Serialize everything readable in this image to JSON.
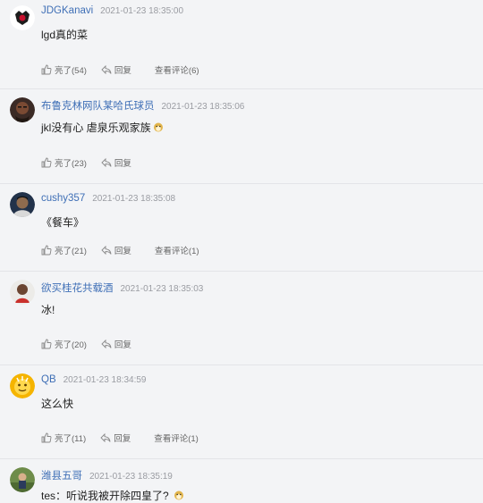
{
  "comments": [
    {
      "username": "JDGKanavi",
      "time": "2021-01-23 18:35:00",
      "text": "lgd真的菜",
      "likes": "亮了(54)",
      "reply": "回复",
      "view": "查看评论(6)"
    },
    {
      "username": "布鲁克林网队某哈氏球员",
      "time": "2021-01-23 18:35:06",
      "text": "jkl没有心 虐泉乐观家族",
      "likes": "亮了(23)",
      "reply": "回复",
      "view": ""
    },
    {
      "username": "cushy357",
      "time": "2021-01-23 18:35:08",
      "text": "《餐车》",
      "likes": "亮了(21)",
      "reply": "回复",
      "view": "查看评论(1)"
    },
    {
      "username": "欲买桂花共载酒",
      "time": "2021-01-23 18:35:03",
      "text": "冰!",
      "likes": "亮了(20)",
      "reply": "回复",
      "view": ""
    },
    {
      "username": "QB",
      "time": "2021-01-23 18:34:59",
      "text": "这么快",
      "likes": "亮了(11)",
      "reply": "回复",
      "view": "查看评论(1)"
    },
    {
      "username": "潍县五哥",
      "time": "2021-01-23 18:35:19",
      "text": "tes：听说我被开除四皇了?",
      "likes": "",
      "reply": "",
      "view": ""
    }
  ],
  "colors": {
    "username": "#3f6fb6",
    "time": "#9a9ca2",
    "divider": "#e3e4e8",
    "background": "#f3f4f6"
  }
}
